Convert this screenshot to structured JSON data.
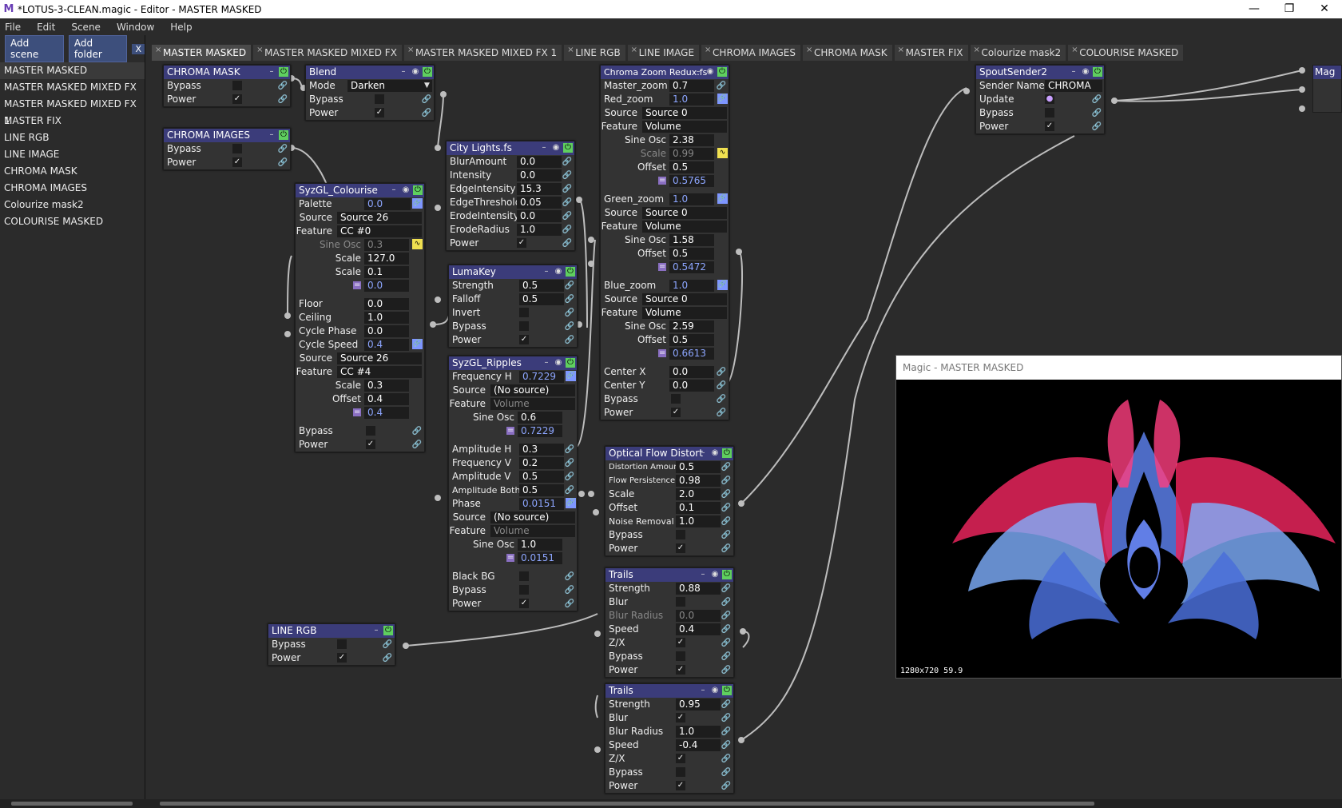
{
  "window": {
    "title": "*LOTUS-3-CLEAN.magic - Editor - MASTER MASKED",
    "logo": "M"
  },
  "menu": [
    "File",
    "Edit",
    "Scene",
    "Window",
    "Help"
  ],
  "sidebar": {
    "add_scene": "Add scene",
    "add_folder": "Add folder",
    "close": "X",
    "scenes": [
      "MASTER MASKED",
      "MASTER MASKED MIXED FX",
      "MASTER MASKED MIXED FX 1",
      "MASTER  FIX",
      "LINE RGB",
      "LINE IMAGE",
      "CHROMA MASK",
      "CHROMA IMAGES",
      "Colourize mask2",
      "COLOURISE MASKED"
    ]
  },
  "tabs": [
    "MASTER MASKED",
    "MASTER MASKED MIXED FX",
    "MASTER MASKED MIXED FX 1",
    "LINE RGB",
    "LINE IMAGE",
    "CHROMA IMAGES",
    "CHROMA MASK",
    "MASTER  FIX",
    "Colourize mask2",
    "COLOURISE MASKED"
  ],
  "nodes": {
    "chroma_mask": {
      "title": "CHROMA MASK",
      "bypass": "Bypass",
      "power": "Power"
    },
    "chroma_images": {
      "title": "CHROMA IMAGES",
      "bypass": "Bypass",
      "power": "Power"
    },
    "blend": {
      "title": "Blend",
      "mode_label": "Mode",
      "mode": "Darken",
      "bypass": "Bypass",
      "power": "Power"
    },
    "syzgl_colourise": {
      "title": "SyzGL_Colourise",
      "palette_label": "Palette",
      "palette": "0.0",
      "source_label": "Source",
      "source": "Source 26",
      "feature_label": "Feature",
      "feature": "CC #0",
      "sine_label": "Sine Osc",
      "sine": "0.3",
      "scale1_label": "Scale",
      "scale1": "127.0",
      "scale2_label": "Scale",
      "scale2": "0.1",
      "eq1": "0.0",
      "floor_label": "Floor",
      "floor": "0.0",
      "ceiling_label": "Ceiling",
      "ceiling": "1.0",
      "phase_label": "Cycle Phase",
      "phase": "0.0",
      "speed_label": "Cycle Speed",
      "speed": "0.4",
      "source2_label": "Source",
      "source2": "Source 26",
      "feature2_label": "Feature",
      "feature2": "CC #4",
      "scale3_label": "Scale",
      "scale3": "0.3",
      "offset_label": "Offset",
      "offset": "0.4",
      "eq2": "0.4",
      "bypass": "Bypass",
      "power": "Power"
    },
    "city_lights": {
      "title": "City Lights.fs",
      "rows": [
        [
          "BlurAmount",
          "0.0"
        ],
        [
          "Intensity",
          "0.0"
        ],
        [
          "EdgeIntensity",
          "15.3"
        ],
        [
          "EdgeThreshold",
          "0.05"
        ],
        [
          "ErodeIntensity",
          "0.0"
        ],
        [
          "ErodeRadius",
          "1.0"
        ]
      ],
      "power": "Power"
    },
    "lumakey": {
      "title": "LumaKey",
      "strength_label": "Strength",
      "strength": "0.5",
      "falloff_label": "Falloff",
      "falloff": "0.5",
      "invert": "Invert",
      "bypass": "Bypass",
      "power": "Power"
    },
    "syzgl_ripples": {
      "title": "SyzGL_Ripples",
      "freqh_label": "Frequency H",
      "freqh": "0.7229",
      "source_label": "Source",
      "source": "(No source)",
      "feature_label": "Feature",
      "feature": "Volume",
      "sine_label": "Sine Osc",
      "sine": "0.6",
      "eq1": "0.7229",
      "rows": [
        [
          "Amplitude H",
          "0.3"
        ],
        [
          "Frequency V",
          "0.2"
        ],
        [
          "Amplitude V",
          "0.5"
        ],
        [
          "Amplitude Both",
          "0.5"
        ]
      ],
      "phase_label": "Phase",
      "phase": "0.0151",
      "source2_label": "Source",
      "source2": "(No source)",
      "feature2_label": "Feature",
      "feature2": "Volume",
      "sine2_label": "Sine Osc",
      "sine2": "1.0",
      "eq2": "0.0151",
      "blackbg": "Black BG",
      "bypass": "Bypass",
      "power": "Power"
    },
    "line_rgb": {
      "title": "LINE RGB",
      "bypass": "Bypass",
      "power": "Power"
    },
    "chroma_zoom": {
      "title": "Chroma Zoom Redux.fs",
      "master_label": "Master_zoom",
      "master": "0.7",
      "red_label": "Red_zoom",
      "red": "1.0",
      "source_label": "Source",
      "source": "Source 0",
      "feature_label": "Feature",
      "feature": "Volume",
      "sine_label": "Sine Osc",
      "sine": "2.38",
      "scale_label": "Scale",
      "scale": "0.99",
      "offset_label": "Offset",
      "offset": "0.5",
      "eq1": "0.5765",
      "green_label": "Green_zoom",
      "green": "1.0",
      "g_source": "Source 0",
      "g_feature": "Volume",
      "g_sine": "1.58",
      "g_offset": "0.5",
      "eq2": "0.5472",
      "blue_label": "Blue_zoom",
      "blue": "1.0",
      "b_source": "Source 0",
      "b_feature": "Volume",
      "b_sine": "2.59",
      "b_offset": "0.5",
      "eq3": "0.6613",
      "centerx_label": "Center X",
      "centerx": "0.0",
      "centery_label": "Center Y",
      "centery": "0.0",
      "bypass": "Bypass",
      "power": "Power"
    },
    "optical_flow": {
      "title": "Optical Flow Distort",
      "rows": [
        [
          "Distortion Amount",
          "0.5"
        ],
        [
          "Flow Persistence",
          "0.98"
        ],
        [
          "Scale",
          "2.0"
        ],
        [
          "Offset",
          "0.1"
        ],
        [
          "Noise Removal",
          "1.0"
        ]
      ],
      "bypass": "Bypass",
      "power": "Power"
    },
    "trails1": {
      "title": "Trails",
      "strength_label": "Strength",
      "strength": "0.88",
      "blur": "Blur",
      "radius_label": "Blur Radius",
      "radius": "0.0",
      "speed_label": "Speed",
      "speed": "0.4",
      "zx": "Z/X",
      "bypass": "Bypass",
      "power": "Power"
    },
    "trails2": {
      "title": "Trails",
      "strength_label": "Strength",
      "strength": "0.95",
      "blur": "Blur",
      "radius_label": "Blur Radius",
      "radius": "1.0",
      "speed_label": "Speed",
      "speed": "-0.4",
      "zx": "Z/X",
      "bypass": "Bypass",
      "power": "Power"
    },
    "spout": {
      "title": "SpoutSender2",
      "sender_label": "Sender Name",
      "sender": "CHROMA",
      "update": "Update",
      "bypass": "Bypass",
      "power": "Power"
    },
    "mag": {
      "title": "Mag"
    }
  },
  "preview": {
    "title": "Magic - MASTER MASKED",
    "info": "1280x720  59.9"
  },
  "colors": {
    "node_header": "#3b3c7a",
    "node_bg": "#333333",
    "power_green": "#5fcf5f",
    "value_blue": "#8da6ff",
    "eq_purple": "#8a6fc2",
    "bg": "#2b2b2b"
  }
}
